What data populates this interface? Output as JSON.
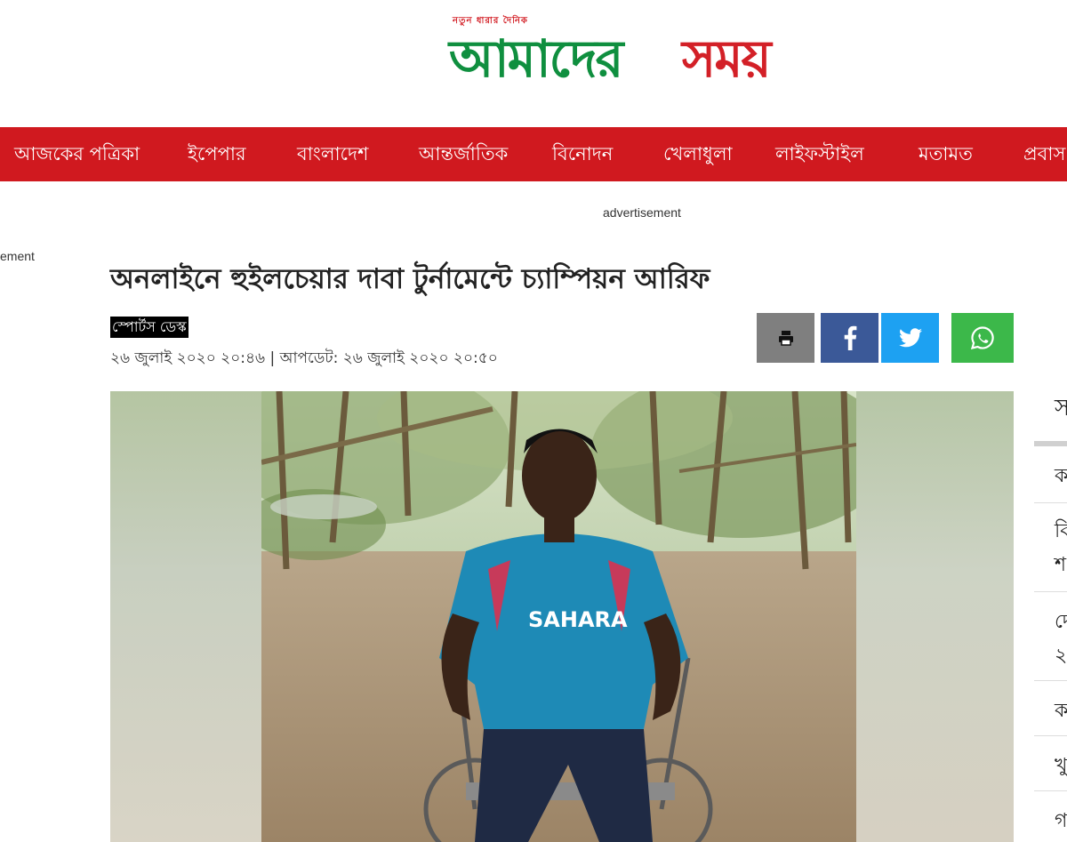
{
  "logo": {
    "tagline": "নতুন ধারার দৈনিক",
    "word_green": "আমাদের",
    "word_red": "সময়"
  },
  "nav": {
    "items": [
      "আজকের পত্রিকা",
      "ইপেপার",
      "বাংলাদেশ",
      "আন্তর্জাতিক",
      "বিনোদন",
      "খেলাধুলা",
      "লাইফস্টাইল",
      "মতামত",
      "প্রবাস"
    ]
  },
  "ads": {
    "center": "advertisement",
    "left": "ement"
  },
  "article": {
    "headline": "অনলাইনে হুইলচেয়ার দাবা টুর্নামেন্টে চ্যাম্পিয়ন আরিফ",
    "author": "স্পোর্টস ডেস্ক",
    "dateline": "২৬ জুলাই ২০২০ ২০:৪৬ | আপডেট: ২৬ জুলাই ২০২০ ২০:৫০"
  },
  "share": {
    "icons": [
      "print-icon",
      "facebook-icon",
      "twitter-icon",
      "whatsapp-icon"
    ],
    "colors": {
      "print": "#7f7f7f",
      "facebook": "#3b5998",
      "twitter": "#1da1f2",
      "whatsapp": "#3cb84a"
    }
  },
  "photo": {
    "jersey_text": "SAHARA"
  },
  "sidebar": {
    "title": "স",
    "items": [
      "ক",
      "বি",
      "শ",
      "দে",
      "২",
      "ক",
      "খু",
      "গ"
    ]
  },
  "colors": {
    "brand_red": "#d0191f",
    "brand_green": "#0f8f3f"
  }
}
